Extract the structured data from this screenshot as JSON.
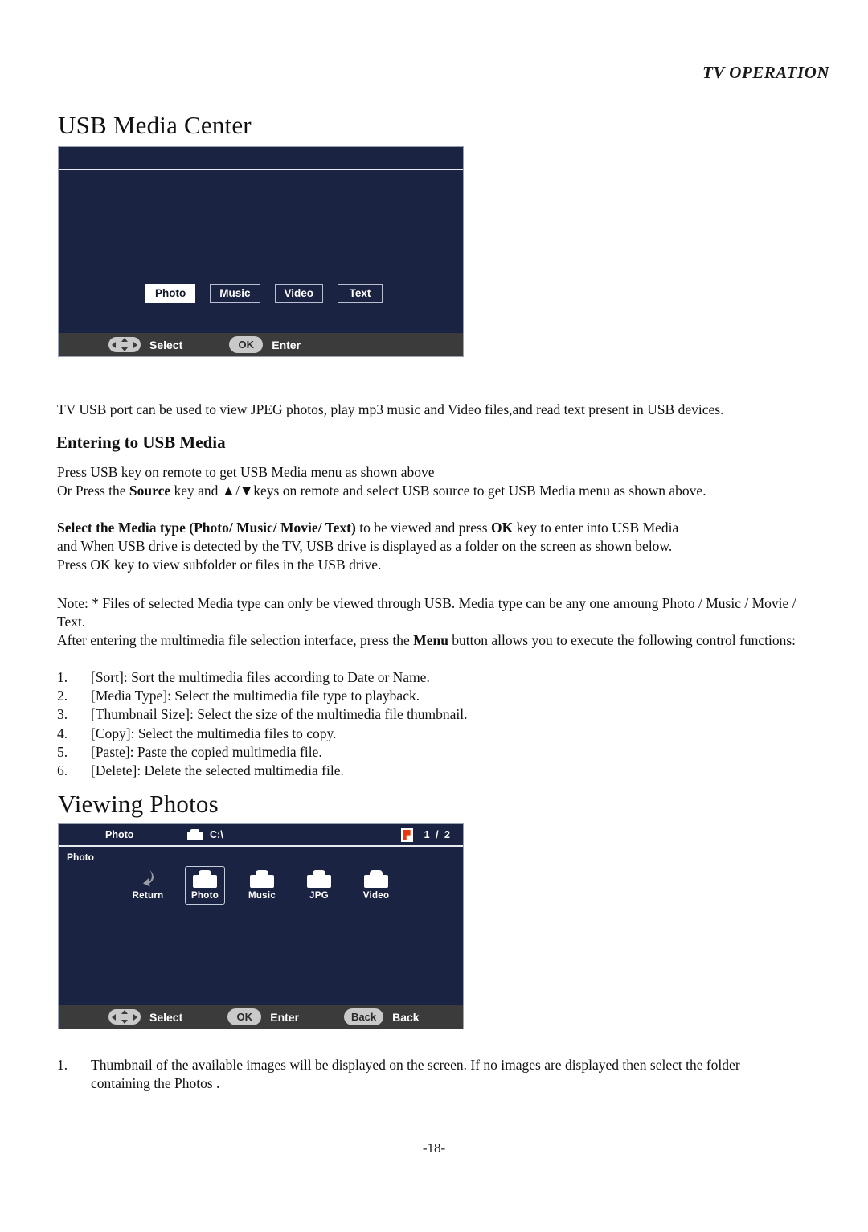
{
  "page": {
    "running_head": "TV OPERATION",
    "page_number": "-18-"
  },
  "sections": {
    "usb_media_center": {
      "title": "USB Media Center",
      "intro": "TV USB port can be used to view JPEG photos, play mp3 music and Video files,and read text present in USB devices.",
      "subheading": "Entering to USB Media",
      "p1_line1": "Press USB key on remote to get USB Media menu as shown above",
      "p1_line2_a": "Or Press the ",
      "p1_line2_b": "Source",
      "p1_line2_c": " key and ▲/▼keys on remote and select USB source to get USB Media menu as shown above.",
      "p2_a": "Select the ",
      "p2_b": "Media type (Photo/ Music/ Movie/ Text)",
      "p2_c": " to be viewed and press ",
      "p2_d": "OK",
      "p2_e": " key to enter into USB Media",
      "p2_line2": "and When USB drive is detected by the TV, USB drive is displayed as a folder on the screen as shown below.",
      "p2_line3": "Press OK key to view subfolder or files in the USB drive.",
      "note": "Note: * Files of selected Media type can only be viewed through USB. Media type can be any one amoung Photo / Music / Movie / Text.",
      "p3_a": "After entering the multimedia file selection interface, press the ",
      "p3_b": "Menu",
      "p3_c": " button allows you to execute the following control functions:",
      "functions": [
        {
          "num": "1.",
          "text": "[Sort]: Sort the multimedia files according to Date or Name."
        },
        {
          "num": "2.",
          "text": "[Media Type]: Select the multimedia file type to playback."
        },
        {
          "num": "3.",
          "text": "[Thumbnail Size]: Select the size of the multimedia file thumbnail."
        },
        {
          "num": "4.",
          "text": "[Copy]: Select the multimedia files to copy."
        },
        {
          "num": "5.",
          "text": "[Paste]: Paste the copied multimedia file."
        },
        {
          "num": "6.",
          "text": "[Delete]: Delete the selected multimedia file."
        }
      ]
    },
    "viewing_photos": {
      "title": "Viewing Photos",
      "steps": [
        {
          "num": "1.",
          "text": "Thumbnail of the available images will be displayed on the screen. If no images are displayed then select the folder containing the Photos ."
        }
      ]
    }
  },
  "screen_media_select": {
    "media_buttons": [
      {
        "label": "Photo",
        "selected": true
      },
      {
        "label": "Music",
        "selected": false
      },
      {
        "label": "Video",
        "selected": false
      },
      {
        "label": "Text",
        "selected": false
      }
    ],
    "footer": [
      {
        "key": "nav-pad",
        "label": "Select"
      },
      {
        "key": "OK",
        "label": "Enter"
      }
    ]
  },
  "screen_browser": {
    "header": {
      "media_type": "Photo",
      "path": "C:\\",
      "page_indicator": "1  / 2"
    },
    "side_label": "Photo",
    "items": [
      {
        "label": "Return",
        "icon": "return-arrow-icon",
        "selected": false
      },
      {
        "label": "Photo",
        "icon": "folder-icon",
        "selected": true
      },
      {
        "label": "Music",
        "icon": "folder-icon",
        "selected": false
      },
      {
        "label": "JPG",
        "icon": "folder-icon",
        "selected": false
      },
      {
        "label": "Video",
        "icon": "folder-icon",
        "selected": false
      }
    ],
    "footer": [
      {
        "key": "nav-pad",
        "label": "Select"
      },
      {
        "key": "OK",
        "label": "Enter"
      },
      {
        "key": "Back",
        "label": "Back"
      }
    ]
  },
  "colors": {
    "screen_navy": "#1b2342",
    "footer_gray": "#3b3b3b",
    "key_pill": "#c9c9c9",
    "accent_red": "#e8380d"
  }
}
